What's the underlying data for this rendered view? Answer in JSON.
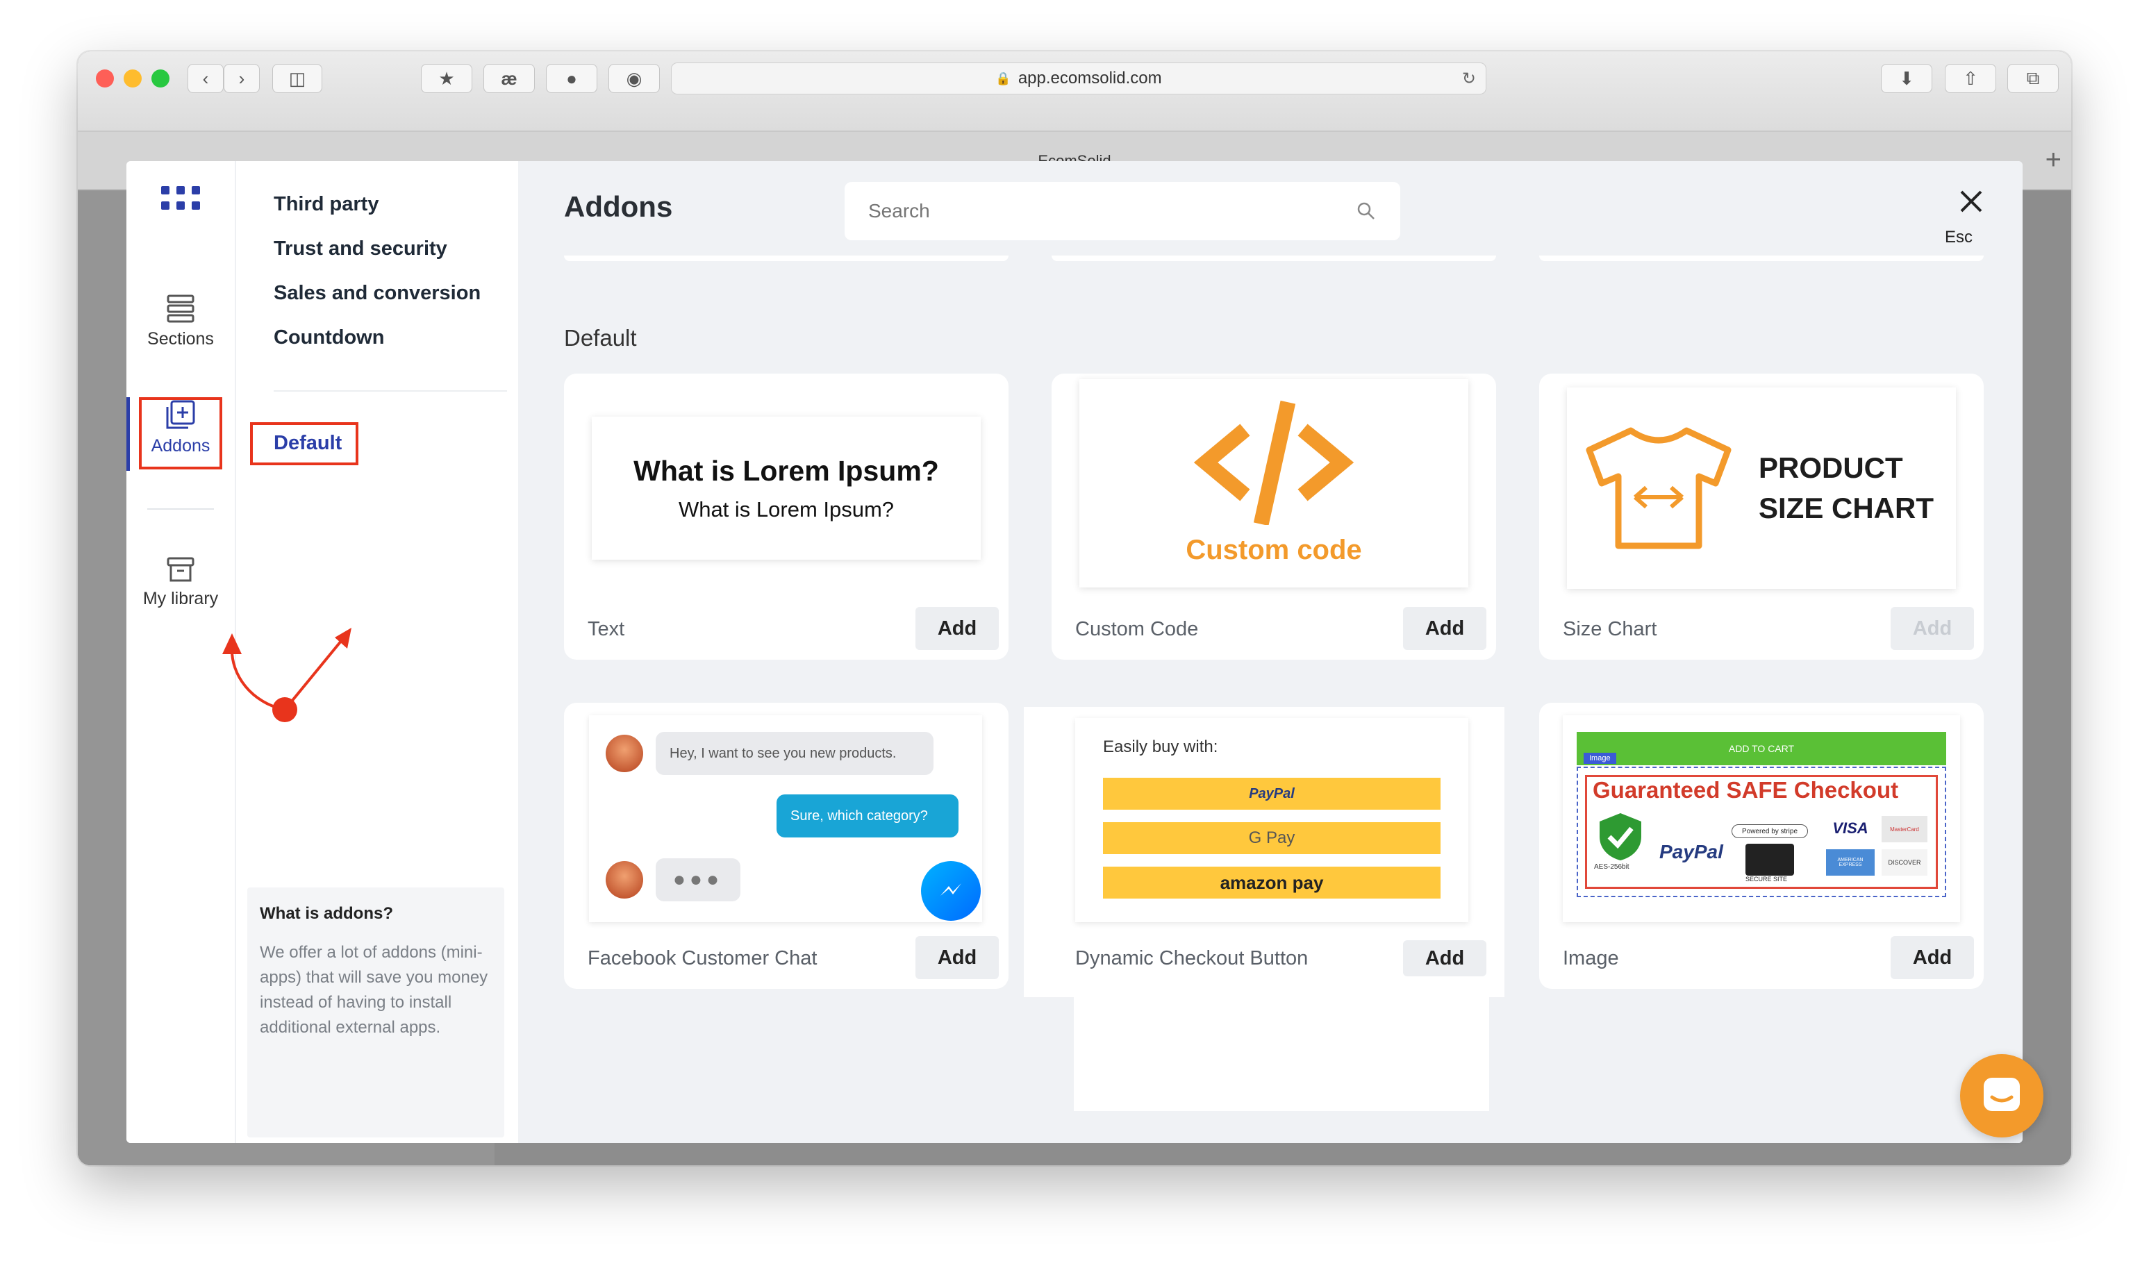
{
  "browser": {
    "url": "app.ecomsolid.com",
    "tab_title": "EcomSolid",
    "colors": {
      "close": "#fe5f57",
      "minimize": "#febc2e",
      "zoom": "#28c840"
    }
  },
  "modal": {
    "title": "Addons",
    "search_placeholder": "Search",
    "close_hint": "Esc",
    "rail": {
      "sections_label": "Sections",
      "addons_label": "Addons",
      "library_label": "My library"
    },
    "categories": [
      "Third party",
      "Trust and security",
      "Sales and conversion",
      "Countdown"
    ],
    "selected_category": "Default",
    "info": {
      "title": "What is addons?",
      "text": "We offer a lot of addons (mini-apps) that will save you money instead of having to install additional external apps."
    },
    "section_heading": "Default",
    "cards": [
      {
        "label": "Text",
        "add": "Add",
        "preview": {
          "heading": "What is Lorem Ipsum?",
          "sub": "What is Lorem Ipsum?"
        }
      },
      {
        "label": "Custom Code",
        "add": "Add",
        "preview": {
          "glyph": "</>",
          "caption": "Custom code"
        }
      },
      {
        "label": "Size Chart",
        "add": "Add",
        "preview": {
          "line1": "PRODUCT",
          "line2": "SIZE CHART"
        }
      },
      {
        "label": "Facebook Customer Chat",
        "add": "Add",
        "preview": {
          "msg1": "Hey, I want to see you new products.",
          "msg2": "Sure, which category?"
        }
      },
      {
        "label": "Dynamic Checkout Button",
        "add": "Add",
        "preview": {
          "title": "Easily buy with:",
          "btn1": "PayPal",
          "btn2": "G Pay",
          "btn3": "amazon pay"
        }
      },
      {
        "label": "Image",
        "add": "Add",
        "preview": {
          "bar": "ADD TO CART",
          "tag": "Image",
          "headline": "Guaranteed SAFE Checkout",
          "aes": "AES-256bit",
          "paypal": "PayPal",
          "powered": "Powered by stripe",
          "secure": "SECURE SITE",
          "visa": "VISA",
          "master": "MasterCard",
          "amex": "AMERICAN EXPRESS",
          "discover": "DISCOVER"
        }
      }
    ]
  },
  "accent": "#2b3ea8",
  "orange": "#f39a2b",
  "annotation_color": "#e8341c"
}
